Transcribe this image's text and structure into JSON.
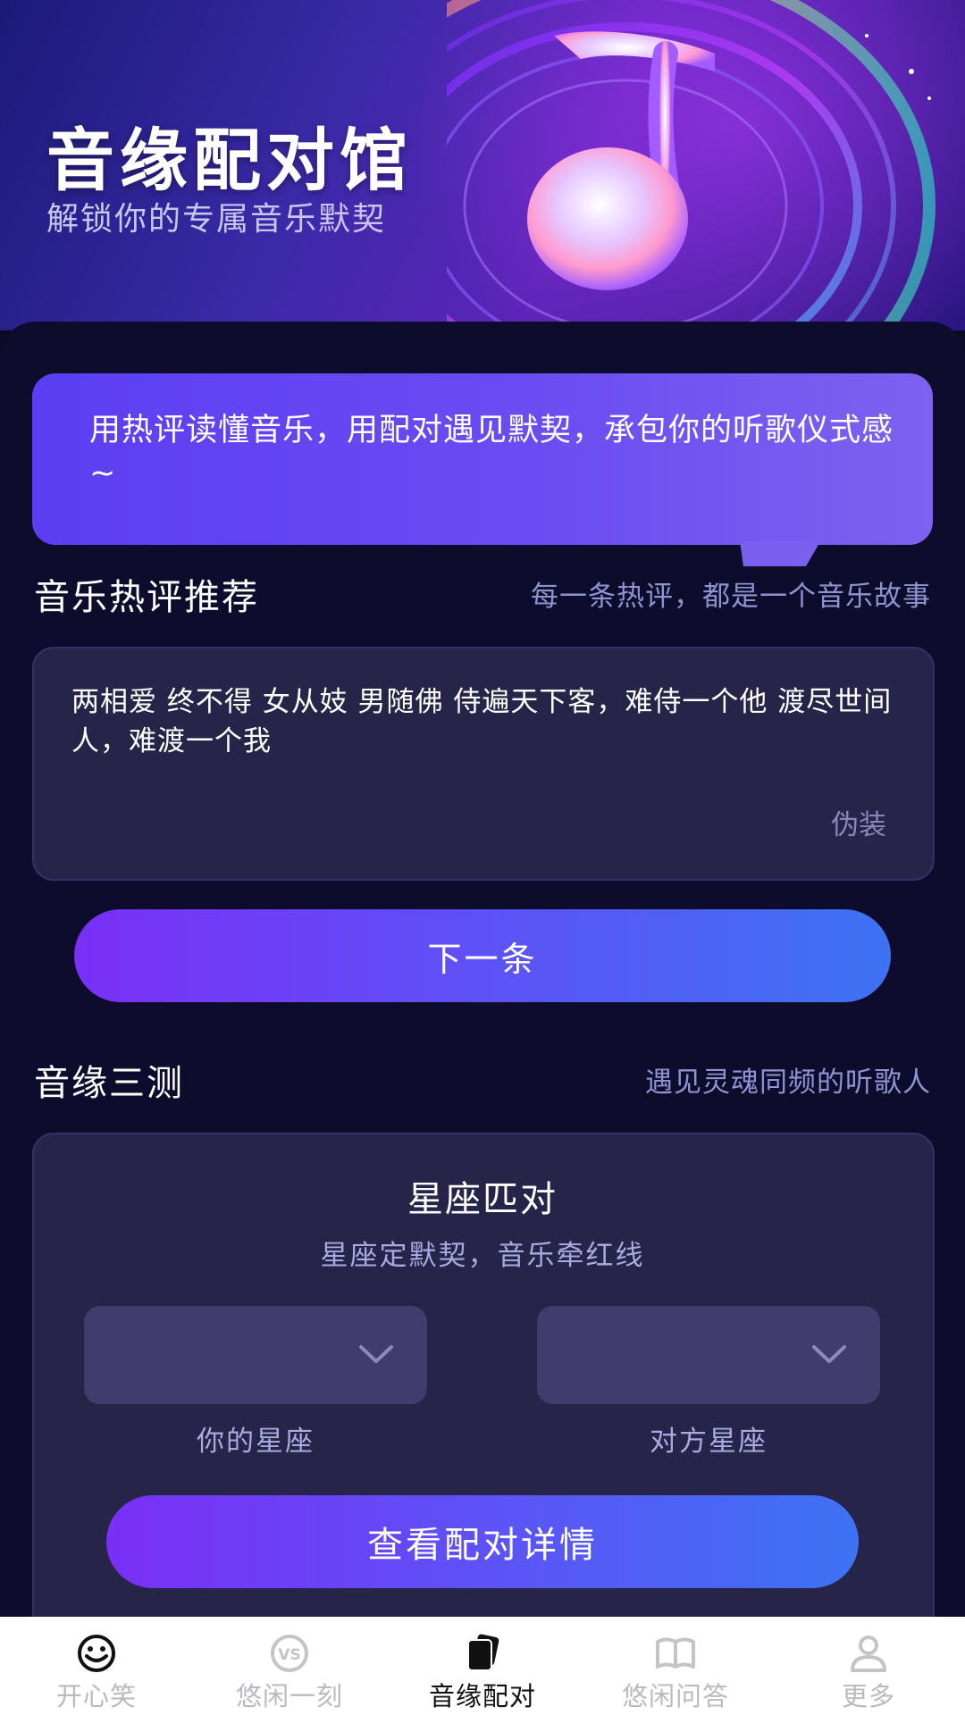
{
  "hero": {
    "title": "音缘配对馆",
    "subtitle": "解锁你的专属音乐默契"
  },
  "intro_bubble": {
    "text": "用热评读懂音乐，用配对遇见默契，承包你的听歌仪式感~"
  },
  "hot_comments": {
    "title": "音乐热评推荐",
    "hint": "每一条热评，都是一个音乐故事",
    "comment_text": "两相爱 终不得 女从妓 男随佛 侍遍天下客，难侍一个他 渡尽世间人，难渡一个我",
    "comment_author": "伪装",
    "next_label": "下一条"
  },
  "match": {
    "section_title": "音缘三测",
    "section_hint": "遇见灵魂同频的听歌人",
    "card_title": "星座匹对",
    "card_subtitle": "星座定默契，音乐牵红线",
    "my_sign_label": "你的星座",
    "other_sign_label": "对方星座",
    "my_sign_value": "",
    "other_sign_value": "",
    "detail_label": "查看配对详情"
  },
  "tabbar": {
    "tabs": [
      {
        "label": "开心笑",
        "icon": "smile-icon",
        "active": false
      },
      {
        "label": "悠闲一刻",
        "icon": "vs-icon",
        "active": false
      },
      {
        "label": "音缘配对",
        "icon": "cards-icon",
        "active": true
      },
      {
        "label": "悠闲问答",
        "icon": "book-icon",
        "active": false
      },
      {
        "label": "更多",
        "icon": "person-icon",
        "active": false
      }
    ]
  },
  "colors": {
    "background": "#0e0c2c",
    "card": "#272449",
    "accent_start": "#7a2ff6",
    "accent_end": "#3d72f3",
    "bubble": "#5b3ef2"
  }
}
